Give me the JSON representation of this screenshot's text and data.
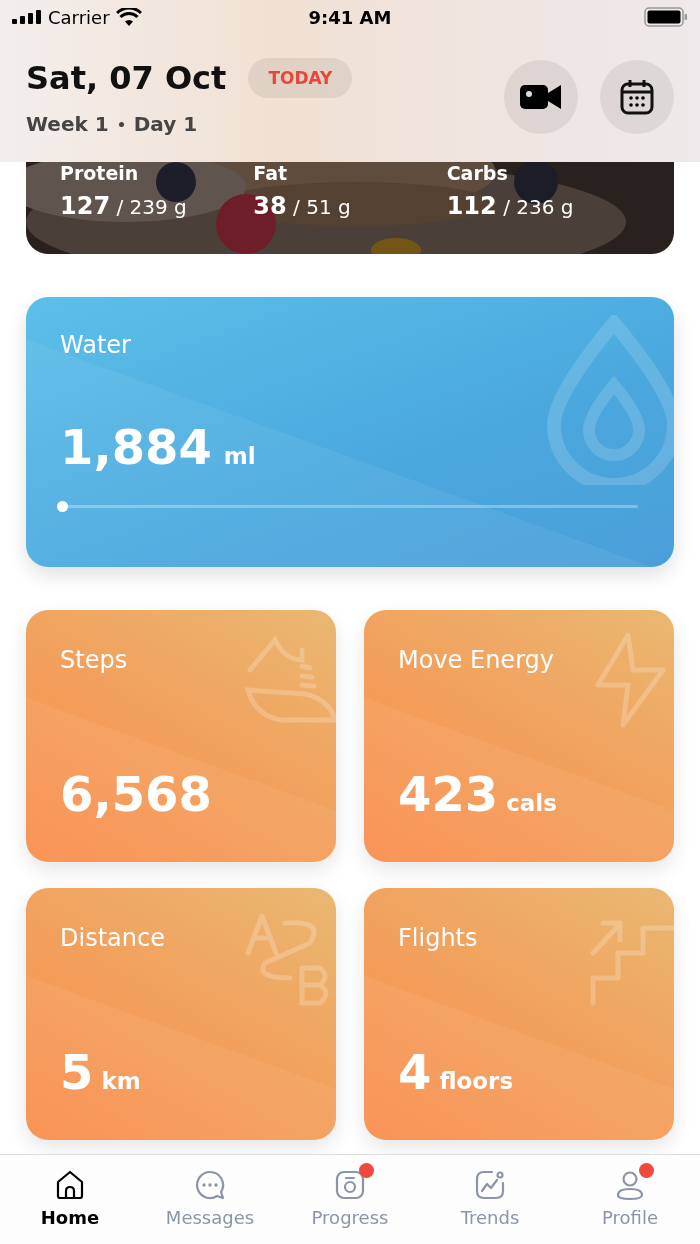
{
  "status_bar": {
    "carrier": "Carrier",
    "time": "9:41 AM"
  },
  "header": {
    "date": "Sat, 07 Oct",
    "badge": "TODAY",
    "week": "Week 1",
    "day": "Day 1"
  },
  "macros": [
    {
      "label": "Protein",
      "value": "127",
      "target": "/ 239 g"
    },
    {
      "label": "Fat",
      "value": "38",
      "target": "/ 51 g"
    },
    {
      "label": "Carbs",
      "value": "112",
      "target": "/ 236 g"
    }
  ],
  "water": {
    "title": "Water",
    "value": "1,884",
    "unit": "ml",
    "level": 0
  },
  "activity": [
    {
      "kind": "steps",
      "title": "Steps",
      "value": "6,568"
    },
    {
      "kind": "energy",
      "title": "Move Energy",
      "value": "423",
      "unit": "cals"
    },
    {
      "kind": "distance",
      "title": "Distance",
      "value": "5",
      "unit": "km"
    },
    {
      "kind": "flights",
      "title": "Flights",
      "value": "4",
      "unit": "floors"
    }
  ],
  "tabs": [
    {
      "kind": "home",
      "label": "Home",
      "selected": true,
      "badge": false
    },
    {
      "kind": "messages",
      "label": "Messages",
      "selected": false,
      "badge": false
    },
    {
      "kind": "progress",
      "label": "Progress",
      "selected": false,
      "badge": true
    },
    {
      "kind": "trends",
      "label": "Trends",
      "selected": false,
      "badge": false
    },
    {
      "kind": "profile",
      "label": "Profile",
      "selected": false,
      "badge": true
    }
  ]
}
